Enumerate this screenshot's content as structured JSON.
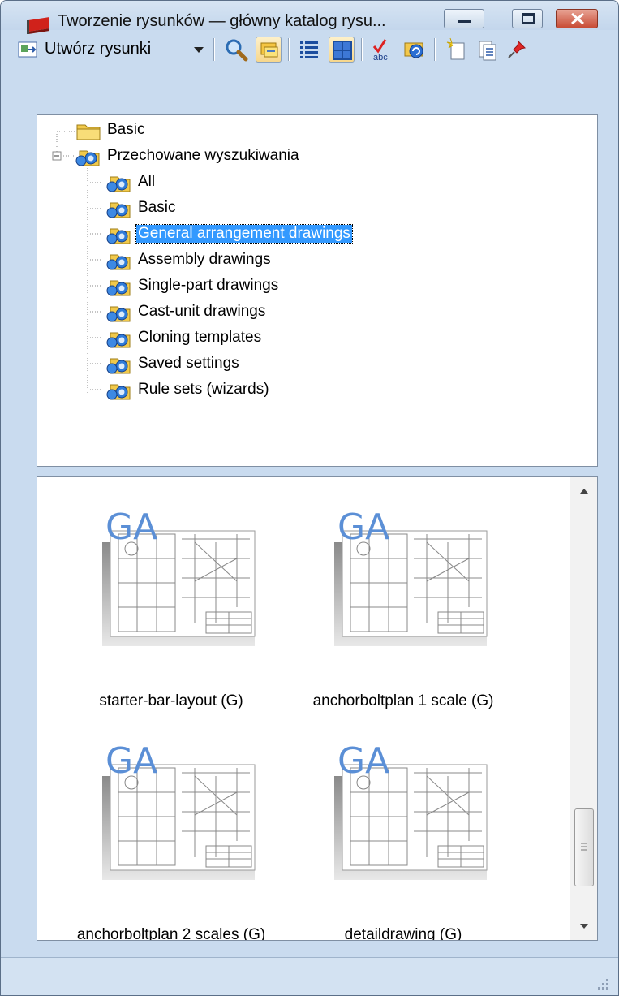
{
  "window": {
    "title": "Tworzenie rysunków — główny katalog rysu..."
  },
  "toolbar": {
    "create_label": "Utwórz rysunki",
    "icons": [
      "search-icon",
      "filter-icon",
      "list-view-icon",
      "thumbnail-view-icon",
      "spellcheck-icon",
      "refresh-icon",
      "new-document-icon",
      "copy-document-icon",
      "pin-icon"
    ]
  },
  "tree": {
    "root_basic": "Basic",
    "saved_searches": "Przechowane wyszukiwania",
    "children": [
      "All",
      "Basic",
      "General arrangement drawings",
      "Assembly drawings",
      "Single-part drawings",
      "Cast-unit drawings",
      "Cloning templates",
      "Saved settings",
      "Rule sets (wizards)"
    ],
    "selected_index": 2
  },
  "thumbnails": {
    "badge": "GA",
    "items": [
      "starter-bar-layout (G)",
      "anchorboltplan 1 scale (G)",
      "anchorboltplan 2 scales (G)",
      "detaildrawing (G)"
    ]
  },
  "status": {
    "text": ""
  },
  "colors": {
    "selection": "#3399ff",
    "badge": "#5b8fd6",
    "window_frame": "#c9dbef"
  }
}
